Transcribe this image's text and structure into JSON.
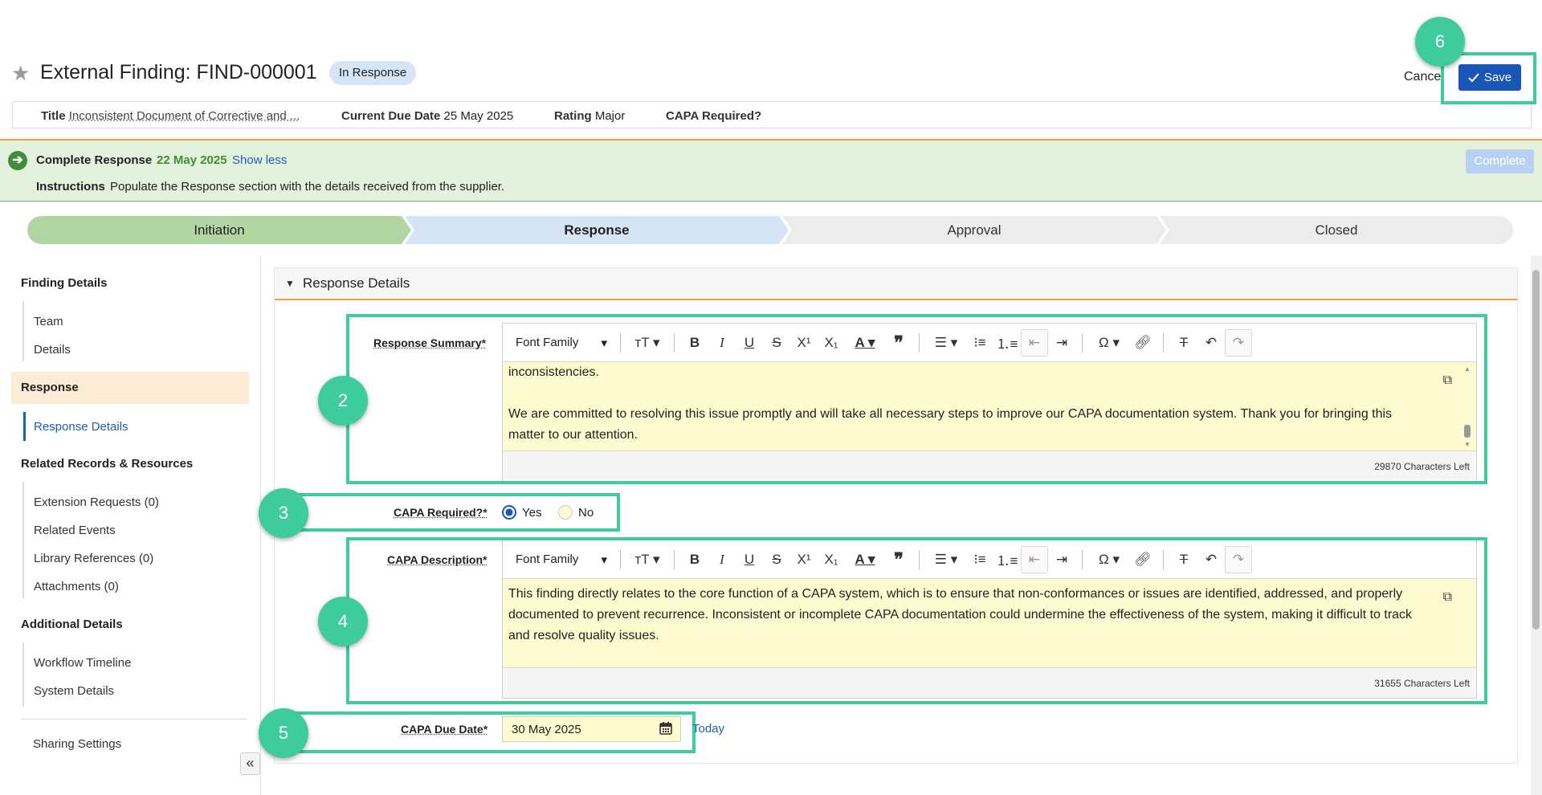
{
  "header": {
    "title": "External Finding: FIND-000001",
    "status": "In Response",
    "cancel_label": "Cancel",
    "save_label": "Save"
  },
  "summary": {
    "title_label": "Title",
    "title_value": "Inconsistent Document of Corrective and ...",
    "due_label": "Current Due Date",
    "due_value": "25 May 2025",
    "rating_label": "Rating",
    "rating_value": "Major",
    "capa_label": "CAPA Required?"
  },
  "task": {
    "label": "Complete Response",
    "date": "22 May 2025",
    "show_less": "Show less",
    "instructions_label": "Instructions",
    "instructions_text": "Populate the Response section with the details received from the supplier.",
    "complete_label": "Complete"
  },
  "stepper": [
    "Initiation",
    "Response",
    "Approval",
    "Closed"
  ],
  "sidebar": {
    "sections": [
      {
        "title": "Finding Details",
        "items": [
          "Team",
          "Details"
        ]
      },
      {
        "title": "Response",
        "items": [
          "Response Details"
        ]
      },
      {
        "title": "Related Records & Resources",
        "items": [
          "Extension Requests (0)",
          "Related Events",
          "Library References (0)",
          "Attachments (0)"
        ]
      },
      {
        "title": "Additional Details",
        "items": [
          "Workflow Timeline",
          "System Details"
        ]
      }
    ],
    "sharing": "Sharing Settings"
  },
  "section": {
    "title": "Response Details"
  },
  "toolbar": {
    "font_family": "Font Family"
  },
  "response_summary": {
    "label": "Response Summary",
    "req": "*",
    "line1": "inconsistencies.",
    "para2": "We are committed to resolving this issue promptly and will take all necessary steps to improve our CAPA documentation system. Thank you for bringing this matter to our attention.",
    "chars_left": "29870 Characters Left"
  },
  "capa_required": {
    "label": "CAPA Required?",
    "req": "*",
    "yes": "Yes",
    "no": "No",
    "selected": "Yes"
  },
  "capa_description": {
    "label": "CAPA Description",
    "req": "*",
    "text": "This finding directly relates to the core function of a CAPA system, which is to ensure that non-conformances or issues are identified, addressed, and properly documented to prevent recurrence. Inconsistent or incomplete CAPA documentation could undermine the effectiveness of the system, making it difficult to track and resolve quality issues.",
    "chars_left": "31655 Characters Left"
  },
  "capa_due_date": {
    "label": "CAPA Due Date",
    "req": "*",
    "value": "30 May 2025",
    "today": "Today"
  },
  "annotations": [
    "2",
    "3",
    "4",
    "5",
    "6"
  ],
  "colors": {
    "highlight": "#3ecc9c",
    "primary": "#1a55b8",
    "link": "#1a5fb8",
    "banner": "#e3f1dd",
    "editor_bg": "#fdfbcf"
  }
}
